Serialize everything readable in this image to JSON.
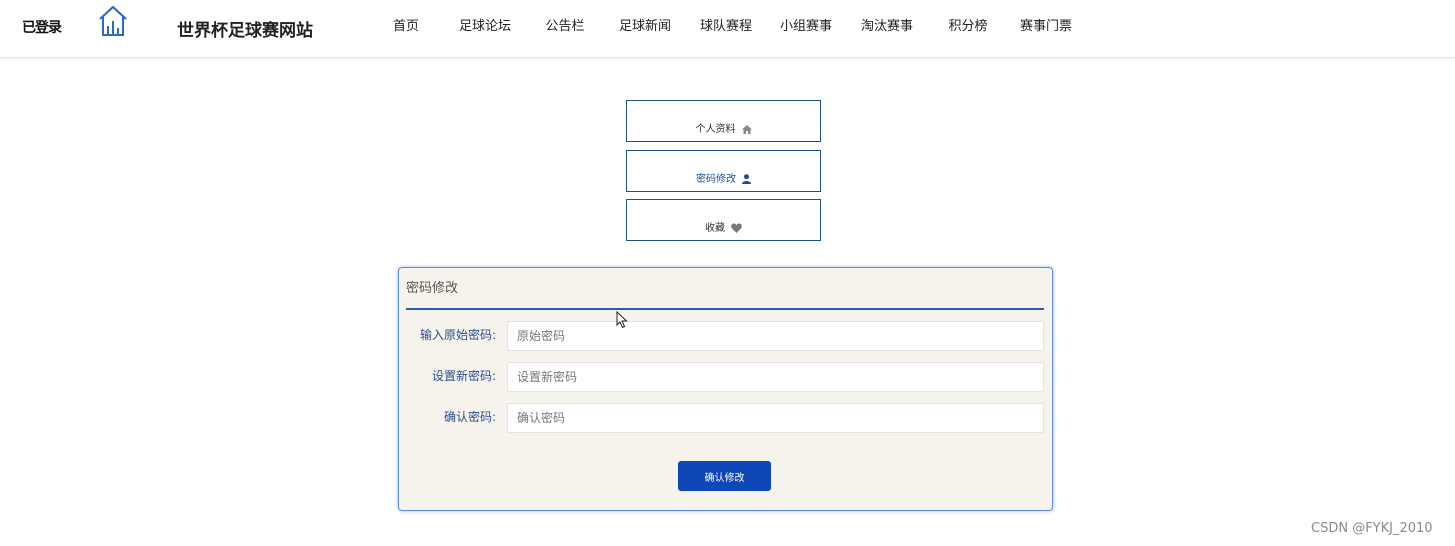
{
  "header": {
    "user_label": "已登录",
    "site_title": "世界杯足球赛网站",
    "nav": [
      "首页",
      "足球论坛",
      "公告栏",
      "足球新闻",
      "球队赛程",
      "小组赛事",
      "淘汰赛事",
      "积分榜",
      "赛事门票"
    ]
  },
  "side_menu": {
    "items": [
      {
        "label": "个人资料",
        "icon": "home-icon"
      },
      {
        "label": "密码修改",
        "icon": "user-icon"
      },
      {
        "label": "收藏",
        "icon": "heart-icon"
      }
    ],
    "active": "密码修改"
  },
  "form": {
    "title": "密码修改",
    "fields": [
      {
        "label": "输入原始密码:",
        "placeholder": "原始密码",
        "value": ""
      },
      {
        "label": "设置新密码:",
        "placeholder": "设置新密码",
        "value": ""
      },
      {
        "label": "确认密码:",
        "placeholder": "确认密码",
        "value": ""
      }
    ],
    "submit_label": "确认修改"
  },
  "watermark": "CSDN @FYKJ_2010",
  "colors": {
    "accent": "#0d47b8",
    "panel_bg": "#f6f3ec",
    "menu_border": "#1e4f85",
    "label": "#2a4f8f"
  }
}
